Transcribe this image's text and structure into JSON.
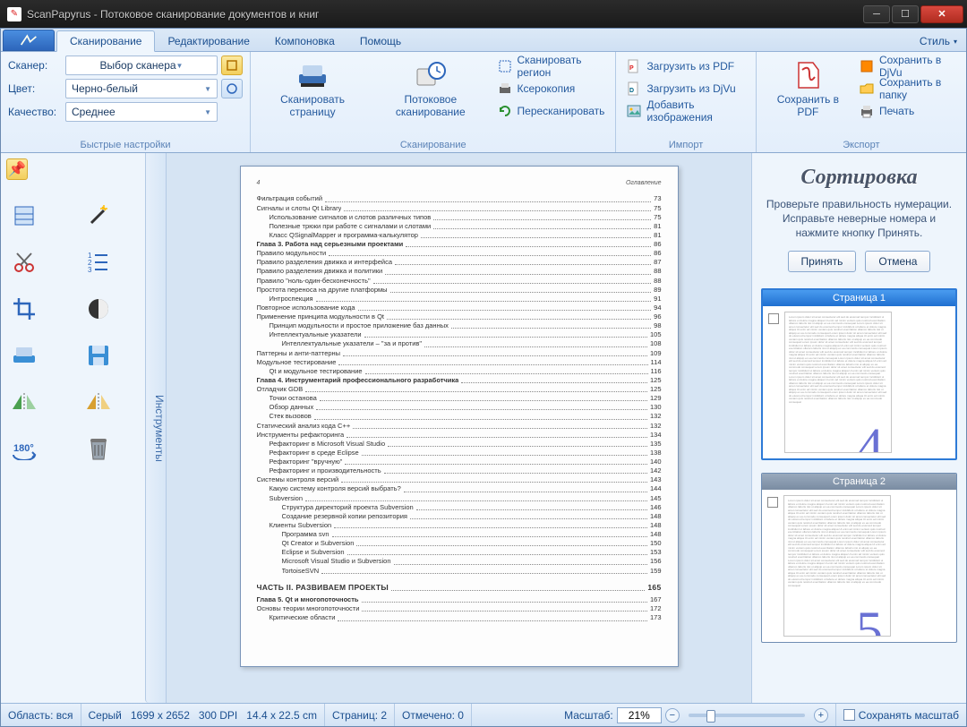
{
  "window": {
    "title": "ScanPapyrus - Потоковое сканирование документов и книг"
  },
  "ribbon": {
    "style_label": "Стиль",
    "tabs": [
      "Сканирование",
      "Редактирование",
      "Компоновка",
      "Помощь"
    ],
    "active_tab": 0,
    "quick": {
      "scanner_label": "Сканер:",
      "scanner_value": "Выбор сканера",
      "color_label": "Цвет:",
      "color_value": "Черно-белый",
      "quality_label": "Качество:",
      "quality_value": "Среднее",
      "group_title": "Быстрые настройки"
    },
    "scan": {
      "scan_page": "Сканировать страницу",
      "batch_scan": "Потоковое сканирование",
      "scan_region": "Сканировать регион",
      "photocopy": "Ксерокопия",
      "rescan": "Пересканировать",
      "group_title": "Сканирование"
    },
    "import": {
      "from_pdf": "Загрузить из PDF",
      "from_djvu": "Загрузить из DjVu",
      "add_images": "Добавить изображения",
      "group_title": "Импорт"
    },
    "export": {
      "save_pdf": "Сохранить в PDF",
      "save_djvu": "Сохранить в DjVu",
      "save_folder": "Сохранить в папку",
      "print": "Печать",
      "group_title": "Экспорт"
    }
  },
  "side_tab": "Инструменты",
  "sorting": {
    "title": "Сортировка",
    "hint": "Проверьте правильность нумерации. Исправьте неверные номера и нажмите кнопку Принять.",
    "accept": "Принять",
    "cancel": "Отмена",
    "pages": [
      {
        "label": "Страница 1",
        "num": "4",
        "selected": true
      },
      {
        "label": "Страница 2",
        "num": "5",
        "selected": false
      }
    ]
  },
  "status": {
    "area": "Область: вся",
    "mode": "Серый",
    "dims": "1699 x 2652",
    "dpi": "300 DPI",
    "physical": "14.4 x 22.5 cm",
    "pages": "Страниц: 2",
    "marked": "Отмечено: 0",
    "zoom_label": "Масштаб:",
    "zoom_value": "21%",
    "save_zoom": "Сохранять масштаб"
  },
  "page": {
    "number": "4",
    "heading": "Оглавление",
    "lines": [
      {
        "t": "Фильтрация событий",
        "p": "73",
        "cls": ""
      },
      {
        "t": "Сигналы и слоты Qt Library",
        "p": "75",
        "cls": ""
      },
      {
        "t": "Использование сигналов и слотов различных типов",
        "p": "75",
        "cls": "i1"
      },
      {
        "t": "Полезные трюки при работе с сигналами и слотами",
        "p": "81",
        "cls": "i1"
      },
      {
        "t": "Класс QSignalMapper и программа-калькулятор",
        "p": "81",
        "cls": "i1"
      },
      {
        "t": "Глава 3. Работа над серьезными проектами",
        "p": "86",
        "cls": "b"
      },
      {
        "t": "Правило модульности",
        "p": "86",
        "cls": ""
      },
      {
        "t": "Правило разделения движка и интерфейса",
        "p": "87",
        "cls": ""
      },
      {
        "t": "Правило разделения движка и политики",
        "p": "88",
        "cls": ""
      },
      {
        "t": "Правило \"ноль-один-бесконечность\"",
        "p": "88",
        "cls": ""
      },
      {
        "t": "Простота переноса на другие платформы",
        "p": "89",
        "cls": ""
      },
      {
        "t": "Интроспекция",
        "p": "91",
        "cls": "i1"
      },
      {
        "t": "Повторное использование кода",
        "p": "94",
        "cls": ""
      },
      {
        "t": "Применение принципа модульности в Qt",
        "p": "96",
        "cls": ""
      },
      {
        "t": "Принцип модульности и простое приложение баз данных",
        "p": "98",
        "cls": "i1"
      },
      {
        "t": "Интеллектуальные указатели",
        "p": "105",
        "cls": "i1"
      },
      {
        "t": "Интеллектуальные указатели – \"за и против\"",
        "p": "108",
        "cls": "i2"
      },
      {
        "t": "Паттерны и анти-паттерны",
        "p": "109",
        "cls": ""
      },
      {
        "t": "Модульное тестирование",
        "p": "114",
        "cls": ""
      },
      {
        "t": "Qt и модульное тестирование",
        "p": "116",
        "cls": "i1"
      },
      {
        "t": "Глава 4. Инструментарий профессионального разработчика",
        "p": "125",
        "cls": "b"
      },
      {
        "t": "Отладчик GDB",
        "p": "125",
        "cls": ""
      },
      {
        "t": "Точки останова",
        "p": "129",
        "cls": "i1"
      },
      {
        "t": "Обзор данных",
        "p": "130",
        "cls": "i1"
      },
      {
        "t": "Стек вызовов",
        "p": "132",
        "cls": "i1"
      },
      {
        "t": "Статический анализ кода C++",
        "p": "132",
        "cls": ""
      },
      {
        "t": "Инструменты рефакторинга",
        "p": "134",
        "cls": ""
      },
      {
        "t": "Рефакторинг в Microsoft Visual Studio",
        "p": "135",
        "cls": "i1"
      },
      {
        "t": "Рефакторинг в среде Eclipse",
        "p": "138",
        "cls": "i1"
      },
      {
        "t": "Рефакторинг \"вручную\"",
        "p": "140",
        "cls": "i1"
      },
      {
        "t": "Рефакторинг и производительность",
        "p": "142",
        "cls": "i1"
      },
      {
        "t": "Системы контроля версий",
        "p": "143",
        "cls": ""
      },
      {
        "t": "Какую систему контроля версий выбрать?",
        "p": "144",
        "cls": "i1"
      },
      {
        "t": "Subversion",
        "p": "145",
        "cls": "i1"
      },
      {
        "t": "Структура директорий проекта Subversion",
        "p": "146",
        "cls": "i2"
      },
      {
        "t": "Создание резервной копии репозитория",
        "p": "148",
        "cls": "i2"
      },
      {
        "t": "Клиенты Subversion",
        "p": "148",
        "cls": "i1"
      },
      {
        "t": "Программа svn",
        "p": "148",
        "cls": "i2"
      },
      {
        "t": "Qt Creator и Subversion",
        "p": "150",
        "cls": "i2"
      },
      {
        "t": "Eclipse и Subversion",
        "p": "153",
        "cls": "i2"
      },
      {
        "t": "Microsoft Visual Studio и Subversion",
        "p": "156",
        "cls": "i2"
      },
      {
        "t": "TortoiseSVN",
        "p": "159",
        "cls": "i2"
      }
    ],
    "section2": "ЧАСТЬ II. РАЗВИВАЕМ ПРОЕКТЫ",
    "section2_p": "165",
    "tail": [
      {
        "t": "Глава 5. Qt и многопоточность",
        "p": "167",
        "cls": "b"
      },
      {
        "t": "Основы теории многопоточности",
        "p": "172",
        "cls": ""
      },
      {
        "t": "Критические области",
        "p": "173",
        "cls": "i1"
      }
    ]
  }
}
